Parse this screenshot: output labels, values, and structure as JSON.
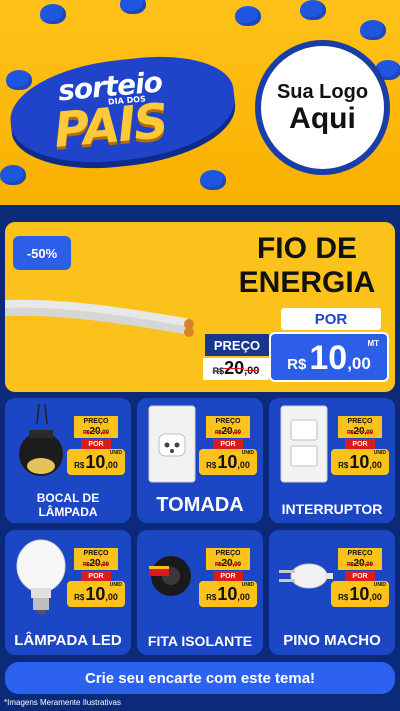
{
  "header": {
    "title_top": "sorteio",
    "title_mid": "DIA DOS",
    "title_main": "PAIS",
    "logo_line1": "Sua Logo",
    "logo_line2": "Aqui"
  },
  "featured": {
    "discount": "-50%",
    "title_line1": "FIO DE",
    "title_line2": "ENERGIA",
    "por_label": "POR",
    "preco_label": "PREÇO",
    "old_currency": "R$",
    "old_int": "20",
    "old_dec": ",00",
    "new_currency": "R$",
    "new_int": "10",
    "new_dec": ",00",
    "unit": "MT"
  },
  "products": [
    {
      "name": "BOCAL DE LÂMPADA",
      "preco_label": "PREÇO",
      "old_currency": "R$",
      "old_int": "20",
      "old_dec": ",00",
      "por_label": "POR",
      "new_currency": "R$",
      "new_int": "10",
      "new_dec": ",00",
      "unit": "UNID"
    },
    {
      "name": "TOMADA",
      "preco_label": "PREÇO",
      "old_currency": "R$",
      "old_int": "20",
      "old_dec": ",00",
      "por_label": "POR",
      "new_currency": "R$",
      "new_int": "10",
      "new_dec": ",00",
      "unit": "UNID"
    },
    {
      "name": "INTERRUPTOR",
      "preco_label": "PREÇO",
      "old_currency": "R$",
      "old_int": "20",
      "old_dec": ",00",
      "por_label": "POR",
      "new_currency": "R$",
      "new_int": "10",
      "new_dec": ",00",
      "unit": "UNID"
    },
    {
      "name": "LÂMPADA LED",
      "preco_label": "PREÇO",
      "old_currency": "R$",
      "old_int": "20",
      "old_dec": ",00",
      "por_label": "POR",
      "new_currency": "R$",
      "new_int": "10",
      "new_dec": ",00",
      "unit": "UNID"
    },
    {
      "name": "FITA ISOLANTE",
      "preco_label": "PREÇO",
      "old_currency": "R$",
      "old_int": "20",
      "old_dec": ",00",
      "por_label": "POR",
      "new_currency": "R$",
      "new_int": "10",
      "new_dec": ",00",
      "unit": "UNID"
    },
    {
      "name": "PINO MACHO",
      "preco_label": "PREÇO",
      "old_currency": "R$",
      "old_int": "20",
      "old_dec": ",00",
      "por_label": "POR",
      "new_currency": "R$",
      "new_int": "10",
      "new_dec": ",00",
      "unit": "UNID"
    }
  ],
  "cta": {
    "label": "Crie seu encarte com este tema!"
  },
  "footnote": "*Imagens Meramente Ilustrativas",
  "colors": {
    "header_yellow": "#ffc21a",
    "page_blue": "#0c2a7a",
    "card_blue": "#1b46c4",
    "accent_blue": "#2d5ee8",
    "price_yellow": "#fbc21b",
    "strike_red": "#d81b1b"
  }
}
